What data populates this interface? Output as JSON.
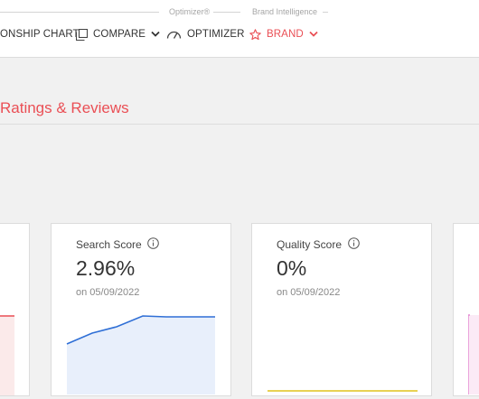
{
  "header": {
    "subheads": {
      "optimizer": "Optimizer®",
      "brand_intelligence": "Brand Intelligence"
    },
    "nav": [
      {
        "label": "ONSHIP CHART",
        "icon": ""
      },
      {
        "label": "COMPARE",
        "icon": "compare-icon"
      },
      {
        "label": "OPTIMIZER",
        "icon": "gauge-icon"
      },
      {
        "label": "BRAND",
        "icon": "star-icon"
      }
    ]
  },
  "section": {
    "title": "Ratings & Reviews"
  },
  "cards": [
    {
      "label": "",
      "value": "",
      "date": "",
      "series_color": "#ea4f55"
    },
    {
      "label": "Search Score",
      "value": "2.96%",
      "date": "on 05/09/2022",
      "series_color": "#2f6fd6"
    },
    {
      "label": "Quality Score",
      "value": "0%",
      "date": "on 05/09/2022",
      "series_color": "#e0c41a"
    },
    {
      "label": "",
      "value": "",
      "date": "",
      "series_color": "#e58bd3"
    }
  ],
  "colors": {
    "accent": "#ea4f55",
    "line_blue": "#2f6fd6",
    "fill_blue": "#e8effb",
    "line_yellow": "#e0c41a"
  }
}
